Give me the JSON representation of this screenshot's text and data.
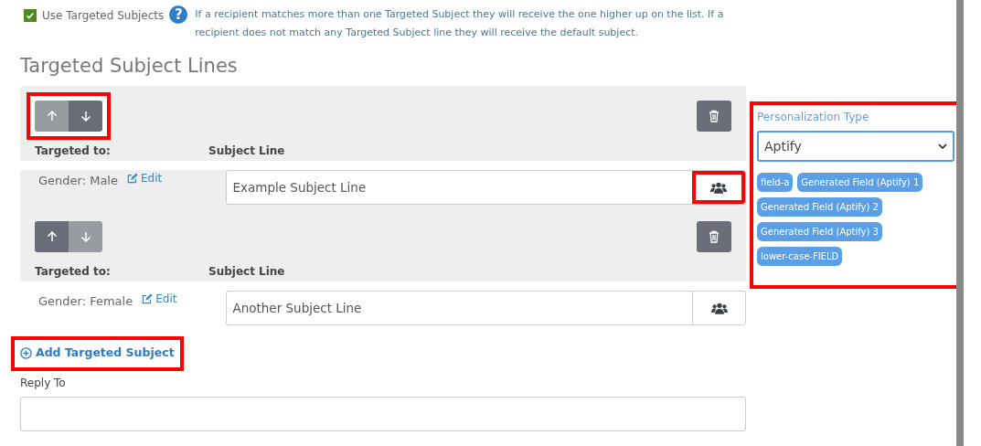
{
  "use_targeted": {
    "checked": true,
    "label": "Use Targeted Subjects",
    "help": "?",
    "note": "If a recipient matches more than one Targeted Subject they will receive the one higher up on the list. If a recipient does not match any Targeted Subject line they will receive the default subject."
  },
  "section_title": "Targeted Subject Lines",
  "targets": [
    {
      "up_disabled": true,
      "down_disabled": false,
      "arrows_highlighted": true,
      "targeted_label": "Targeted to:",
      "subject_label": "Subject Line",
      "target": "Gender: Male",
      "edit": "Edit",
      "subject": "Example Subject Line",
      "personalize_highlighted": true
    },
    {
      "up_disabled": false,
      "down_disabled": true,
      "arrows_highlighted": false,
      "targeted_label": "Targeted to:",
      "subject_label": "Subject Line",
      "target": "Gender: Female",
      "edit": "Edit",
      "subject": "Another Subject Line",
      "personalize_highlighted": false
    }
  ],
  "add_link": {
    "label": "Add Targeted Subject",
    "highlighted": true
  },
  "reply_to": {
    "label": "Reply To"
  },
  "personalization": {
    "highlighted": true,
    "label": "Personalization Type",
    "value": "Aptify",
    "fields": [
      "field-a",
      "Generated Field (Aptify) 1",
      "Generated Field (Aptify) 2",
      "Generated Field (Aptify) 3",
      "lower-case-FIELD"
    ]
  }
}
